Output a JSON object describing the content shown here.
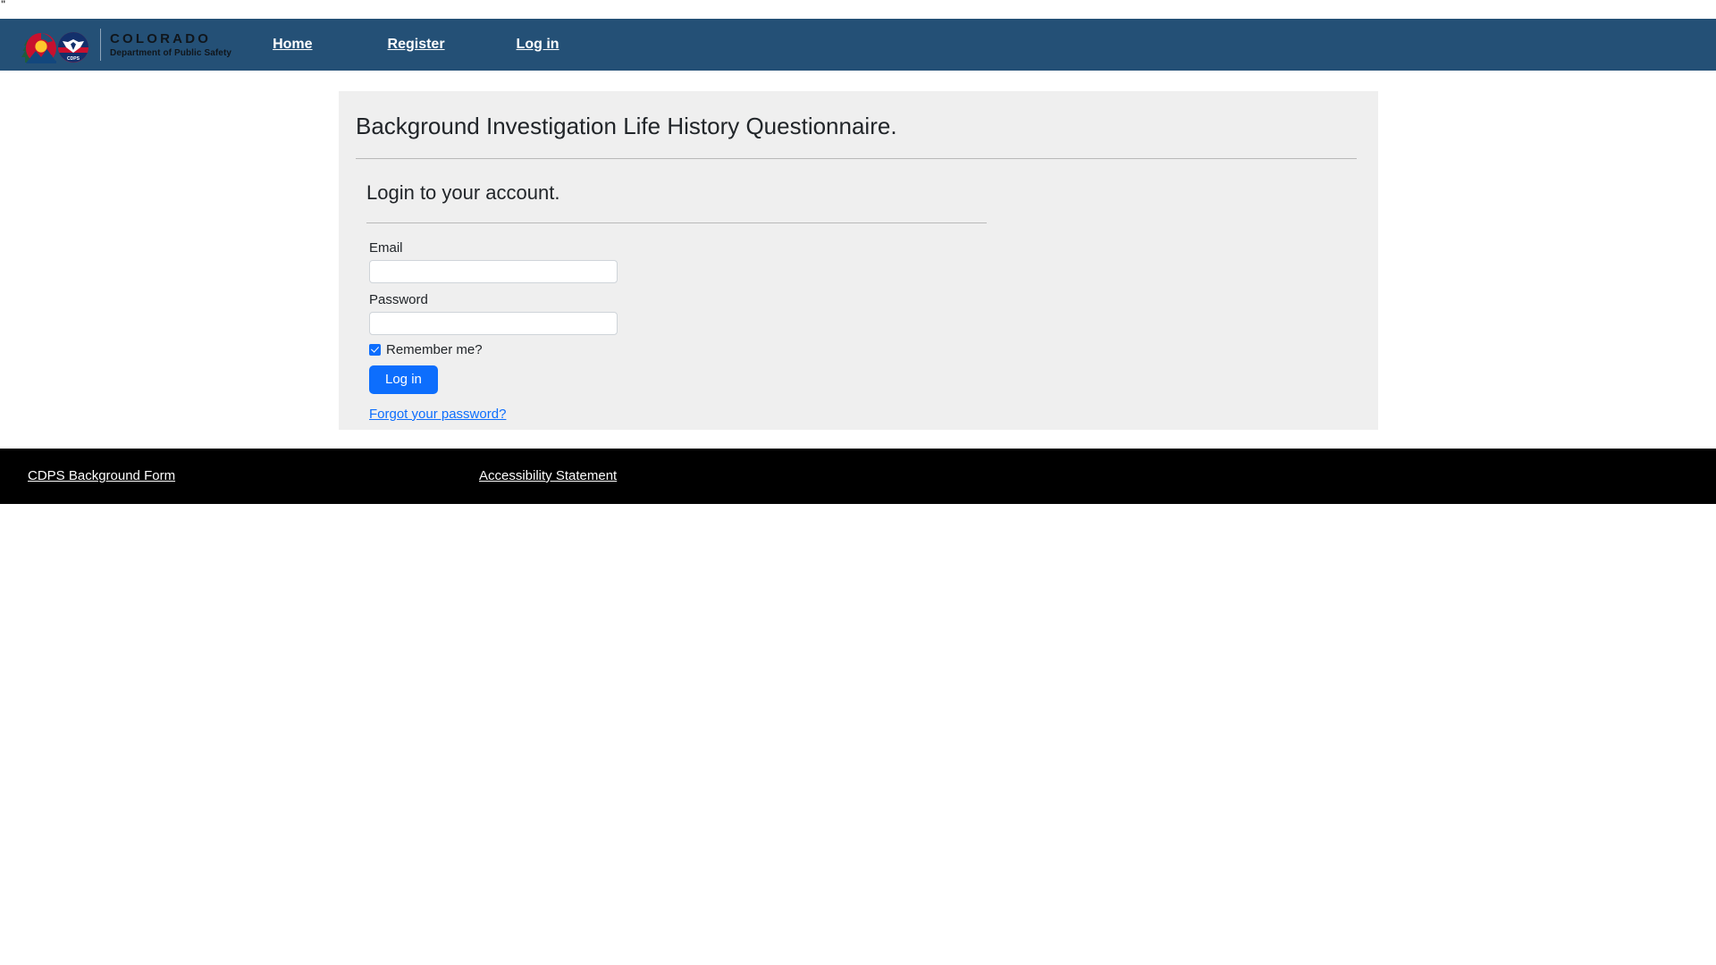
{
  "artifact": {
    "glyph": "\""
  },
  "navbar": {
    "brand": {
      "org_line1": "COLORADO",
      "org_line2": "Department of Public Safety",
      "shield_label": "CDPS"
    },
    "links": [
      {
        "label": "Home"
      },
      {
        "label": "Register"
      },
      {
        "label": "Log in"
      }
    ]
  },
  "card": {
    "title": "Background Investigation Life History Questionnaire.",
    "section_title": "Login to your account.",
    "form": {
      "email_label": "Email",
      "email_value": "",
      "email_placeholder": "",
      "password_label": "Password",
      "password_value": "",
      "password_placeholder": "",
      "remember_label": "Remember me?",
      "remember_checked": true,
      "submit_label": "Log in",
      "forgot_label": "Forgot your password?"
    }
  },
  "footer": {
    "links": [
      {
        "label": "CDPS Background Form"
      },
      {
        "label": "Accessibility Statement"
      }
    ]
  },
  "colors": {
    "navbar_bg": "#245076",
    "card_bg": "#efefef",
    "accent_blue": "#0d6efd",
    "footer_bg": "#000000",
    "page_bg": "#ffffff"
  }
}
